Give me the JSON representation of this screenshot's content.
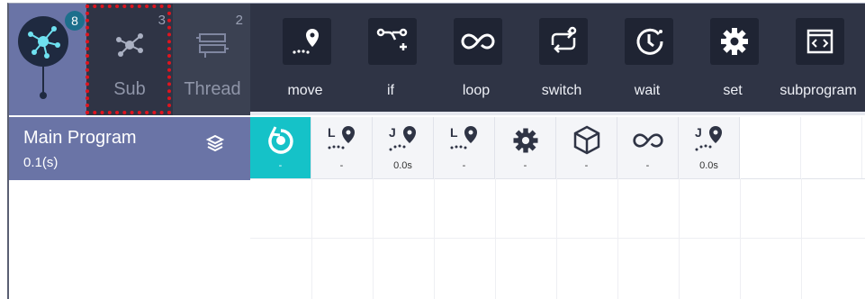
{
  "tabs": {
    "main_badge": "8",
    "sub": {
      "count": "3",
      "label": "Sub"
    },
    "thread": {
      "count": "2",
      "label": "Thread"
    }
  },
  "toolbar": [
    {
      "id": "move",
      "label": "move",
      "icon": "waypoint-icon"
    },
    {
      "id": "if",
      "label": "if",
      "icon": "branch-icon"
    },
    {
      "id": "loop",
      "label": "loop",
      "icon": "infinity-icon"
    },
    {
      "id": "switch",
      "label": "switch",
      "icon": "switch-icon"
    },
    {
      "id": "wait",
      "label": "wait",
      "icon": "clock-icon"
    },
    {
      "id": "set",
      "label": "set",
      "icon": "gear-icon"
    },
    {
      "id": "subprogram",
      "label": "subprogram",
      "icon": "code-icon"
    }
  ],
  "program": {
    "title": "Main Program",
    "time": "0.1(s)"
  },
  "commands": [
    {
      "icon": "restart-icon",
      "value": "-",
      "active": true
    },
    {
      "icon": "linear-move-icon",
      "prefix": "L",
      "value": "-"
    },
    {
      "icon": "joint-move-icon",
      "prefix": "J",
      "value": "0.0s"
    },
    {
      "icon": "linear-move-icon",
      "prefix": "L",
      "value": "-"
    },
    {
      "icon": "gear-icon",
      "value": "-"
    },
    {
      "icon": "cube-icon",
      "value": "-"
    },
    {
      "icon": "infinity-icon",
      "value": "-"
    },
    {
      "icon": "joint-move-icon",
      "prefix": "J",
      "value": "0.0s"
    }
  ],
  "colors": {
    "accent": "#15c2c8",
    "program_bar": "#6a74a6",
    "toolbar": "#2f3445",
    "highlight": "#e0141e"
  }
}
